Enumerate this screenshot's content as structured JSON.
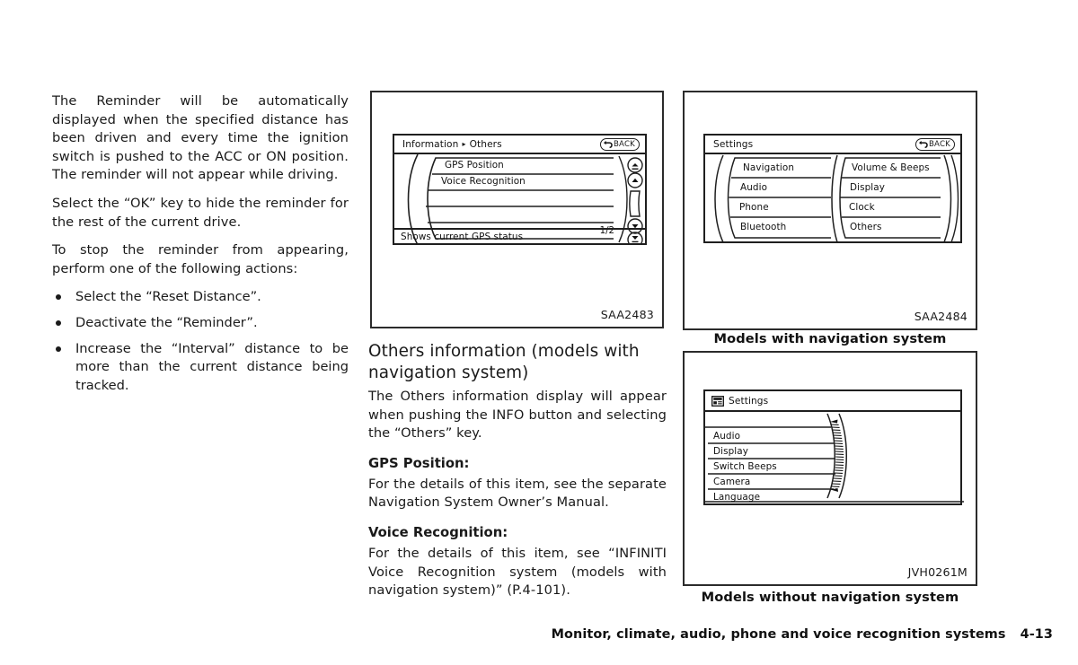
{
  "left_column": {
    "paragraphs": [
      "The Reminder will be automatically displayed when the specified distance has been driven and every time the ignition switch is pushed to the ACC or ON position. The reminder will not appear while driving.",
      "Select the “OK” key to hide the reminder for the rest of the current drive.",
      "To stop the reminder from appearing, perform one of the following actions:"
    ],
    "bullets": [
      "Select the “Reset Distance”.",
      "Deactivate the “Reminder”.",
      "Increase the “Interval” distance to be more than the current distance being tracked."
    ]
  },
  "middle_column": {
    "section_title": "Others information (models with navigation system)",
    "intro": "The Others information display will appear when pushing the INFO button and selecting the “Others” key.",
    "subsections": [
      {
        "heading": "GPS Position:",
        "body": "For the details of this item, see the separate Navigation System Owner’s Manual."
      },
      {
        "heading": "Voice Recognition:",
        "body": "For the details of this item, see “INFINITI Voice Recognition system (models with navigation system)” (P.4-101)."
      }
    ]
  },
  "figure_1": {
    "code": "SAA2483",
    "screen": {
      "breadcrumb_root": "Information",
      "breadcrumb_sep": "▸",
      "breadcrumb_leaf": "Others",
      "back_label": "BACK",
      "back_icon": "back-arrow-icon",
      "rows": [
        "GPS Position",
        "Voice Recognition",
        "",
        "",
        ""
      ],
      "page_indicator": "1/2",
      "status_text": "Shows current GPS status",
      "scroll_controls": [
        "scroll-top-icon",
        "scroll-up-icon",
        "scrollbar-thumb",
        "scroll-down-icon",
        "scroll-bottom-icon"
      ]
    }
  },
  "figure_2": {
    "code": "SAA2484",
    "caption": "Models with navigation system",
    "screen": {
      "title": "Settings",
      "back_label": "BACK",
      "back_icon": "back-arrow-icon",
      "left_items": [
        "Navigation",
        "Audio",
        "Phone",
        "Bluetooth"
      ],
      "right_items": [
        "Volume & Beeps",
        "Display",
        "Clock",
        "Others"
      ]
    }
  },
  "figure_3": {
    "code": "JVH0261M",
    "caption": "Models without navigation system",
    "screen": {
      "title": "Settings",
      "title_icon": "display-settings-icon",
      "items": [
        "Audio",
        "Display",
        "Switch Beeps",
        "Camera",
        "Language"
      ],
      "scrollbar_icon": "curved-scrollbar-icon"
    }
  },
  "footer": {
    "chapter": "Monitor, climate, audio, phone and voice recognition systems",
    "page": "4-13"
  }
}
